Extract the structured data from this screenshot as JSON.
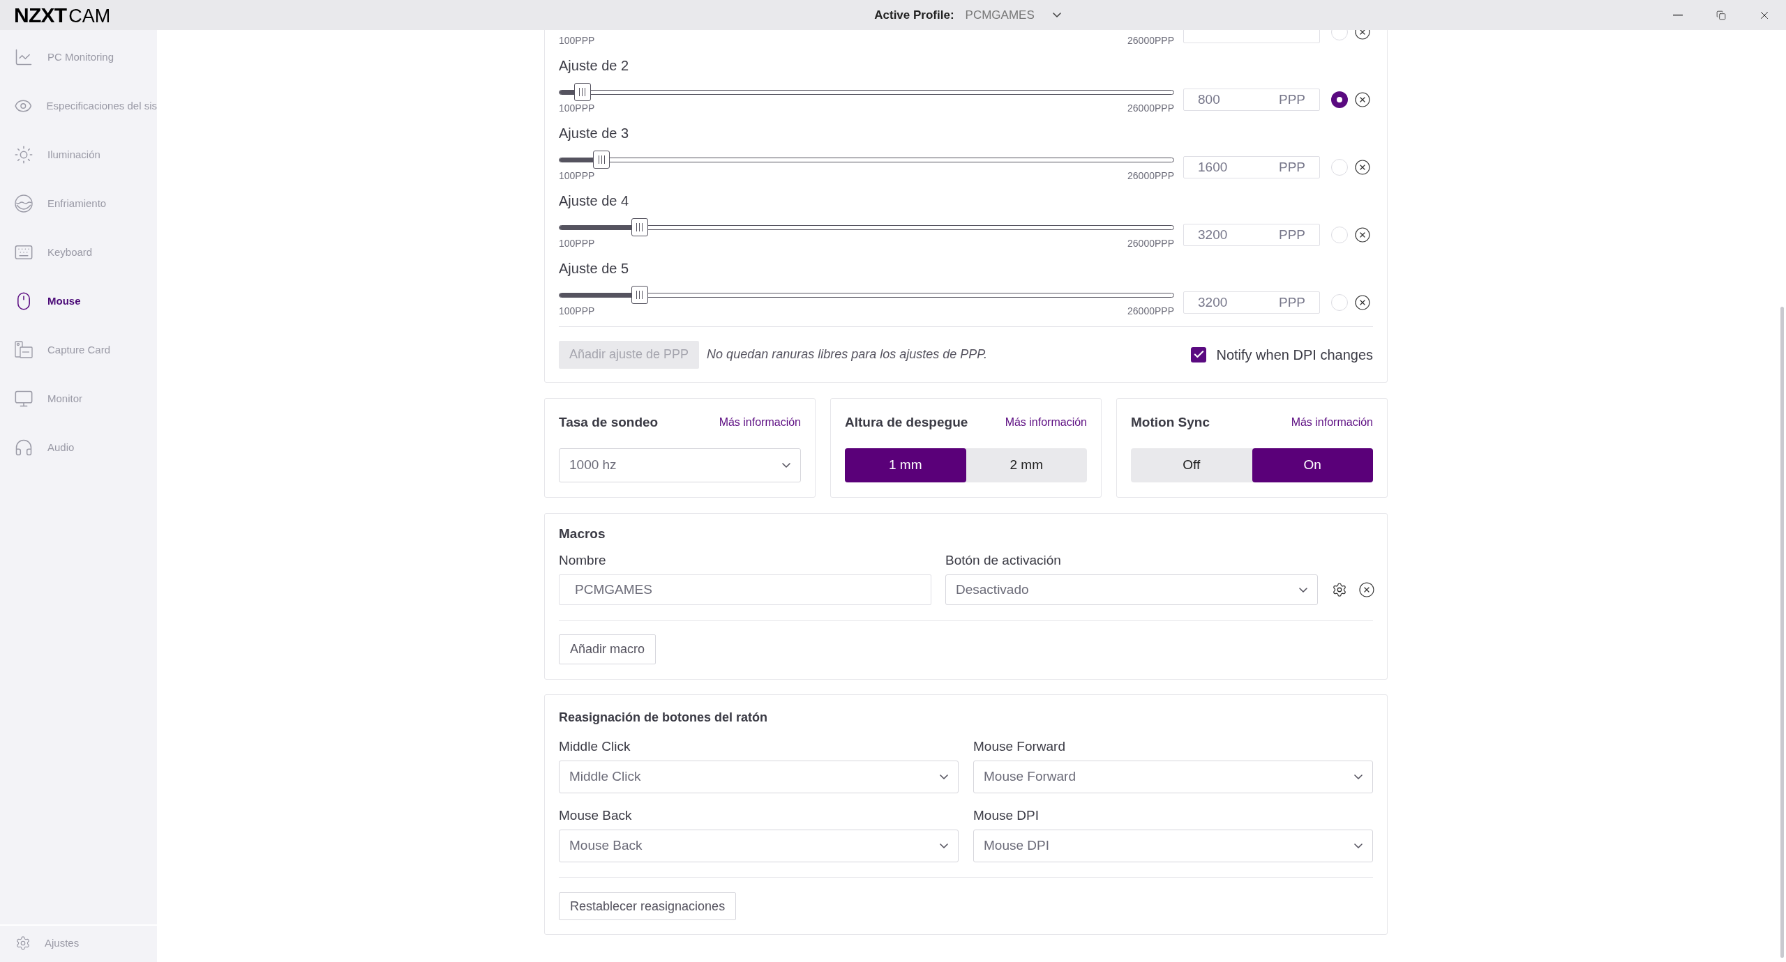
{
  "app": {
    "logo_bold": "NZXT",
    "logo_light": "CAM"
  },
  "title_bar": {
    "profile_label": "Active Profile:",
    "profile_value": "PCMGAMES"
  },
  "sidebar": {
    "items": [
      {
        "kind": "chart",
        "label": "PC Monitoring",
        "selected": false
      },
      {
        "kind": "eye",
        "label": "Especificaciones del sis",
        "selected": false
      },
      {
        "kind": "sun",
        "label": "Iluminación",
        "selected": false
      },
      {
        "kind": "cooling",
        "label": "Enfriamiento",
        "selected": false
      },
      {
        "kind": "keyboard",
        "label": "Keyboard",
        "selected": false
      },
      {
        "kind": "mouse",
        "label": "Mouse",
        "selected": true
      },
      {
        "kind": "capture",
        "label": "Capture Card",
        "selected": false
      },
      {
        "kind": "monitor",
        "label": "Monitor",
        "selected": false
      },
      {
        "kind": "headset",
        "label": "Audio",
        "selected": false
      }
    ],
    "settings": {
      "label": "Ajustes"
    }
  },
  "dpi": {
    "rows": [
      {
        "min": "100PPP",
        "max": "26000PPP",
        "selected": false
      },
      {
        "label": "Ajuste de 2",
        "level": 0.027,
        "min": "100PPP",
        "max": "26000PPP",
        "value": "800",
        "unit": "PPP",
        "selected": true
      },
      {
        "label": "Ajuste de 3",
        "level": 0.058,
        "min": "100PPP",
        "max": "26000PPP",
        "value": "1600",
        "unit": "PPP",
        "selected": false
      },
      {
        "label": "Ajuste de 4",
        "level": 0.12,
        "min": "100PPP",
        "max": "26000PPP",
        "value": "3200",
        "unit": "PPP",
        "selected": false
      },
      {
        "label": "Ajuste de 5",
        "level": 0.12,
        "min": "100PPP",
        "max": "26000PPP",
        "value": "3200",
        "unit": "PPP",
        "selected": false
      }
    ],
    "add_button": {
      "label": "Añadir ajuste de PPP",
      "disabled": true
    },
    "note": "No quedan ranuras libres para los ajustes de PPP.",
    "notify": {
      "label": "Notify when DPI changes",
      "checked": true
    }
  },
  "settings_cards": [
    {
      "kind": "select",
      "title": "Tasa de sondeo",
      "link": "Más información",
      "value": "1000 hz"
    },
    {
      "kind": "toggle",
      "title": "Altura de despegue",
      "link": "Más información",
      "options": [
        {
          "label": "1 mm",
          "selected": true
        },
        {
          "label": "2 mm",
          "selected": false
        }
      ]
    },
    {
      "kind": "toggle",
      "title": "Motion Sync",
      "link": "Más información",
      "options": [
        {
          "label": "Off",
          "selected": false
        },
        {
          "label": "On",
          "selected": true
        }
      ]
    }
  ],
  "macros": {
    "title": "Macros",
    "name_label": "Nombre",
    "trigger_label": "Botón de activación",
    "rows": [
      {
        "name": "PCMGAMES",
        "trigger": "Desactivado"
      }
    ],
    "add_button": "Añadir macro"
  },
  "remap": {
    "title": "Reasignación de botones del ratón",
    "fields": [
      {
        "label": "Middle Click",
        "value": "Middle Click"
      },
      {
        "label": "Mouse Forward",
        "value": "Mouse Forward"
      },
      {
        "label": "Mouse Back",
        "value": "Mouse Back"
      },
      {
        "label": "Mouse DPI",
        "value": "Mouse DPI"
      }
    ],
    "reset_button": "Restablecer reasignaciones"
  }
}
